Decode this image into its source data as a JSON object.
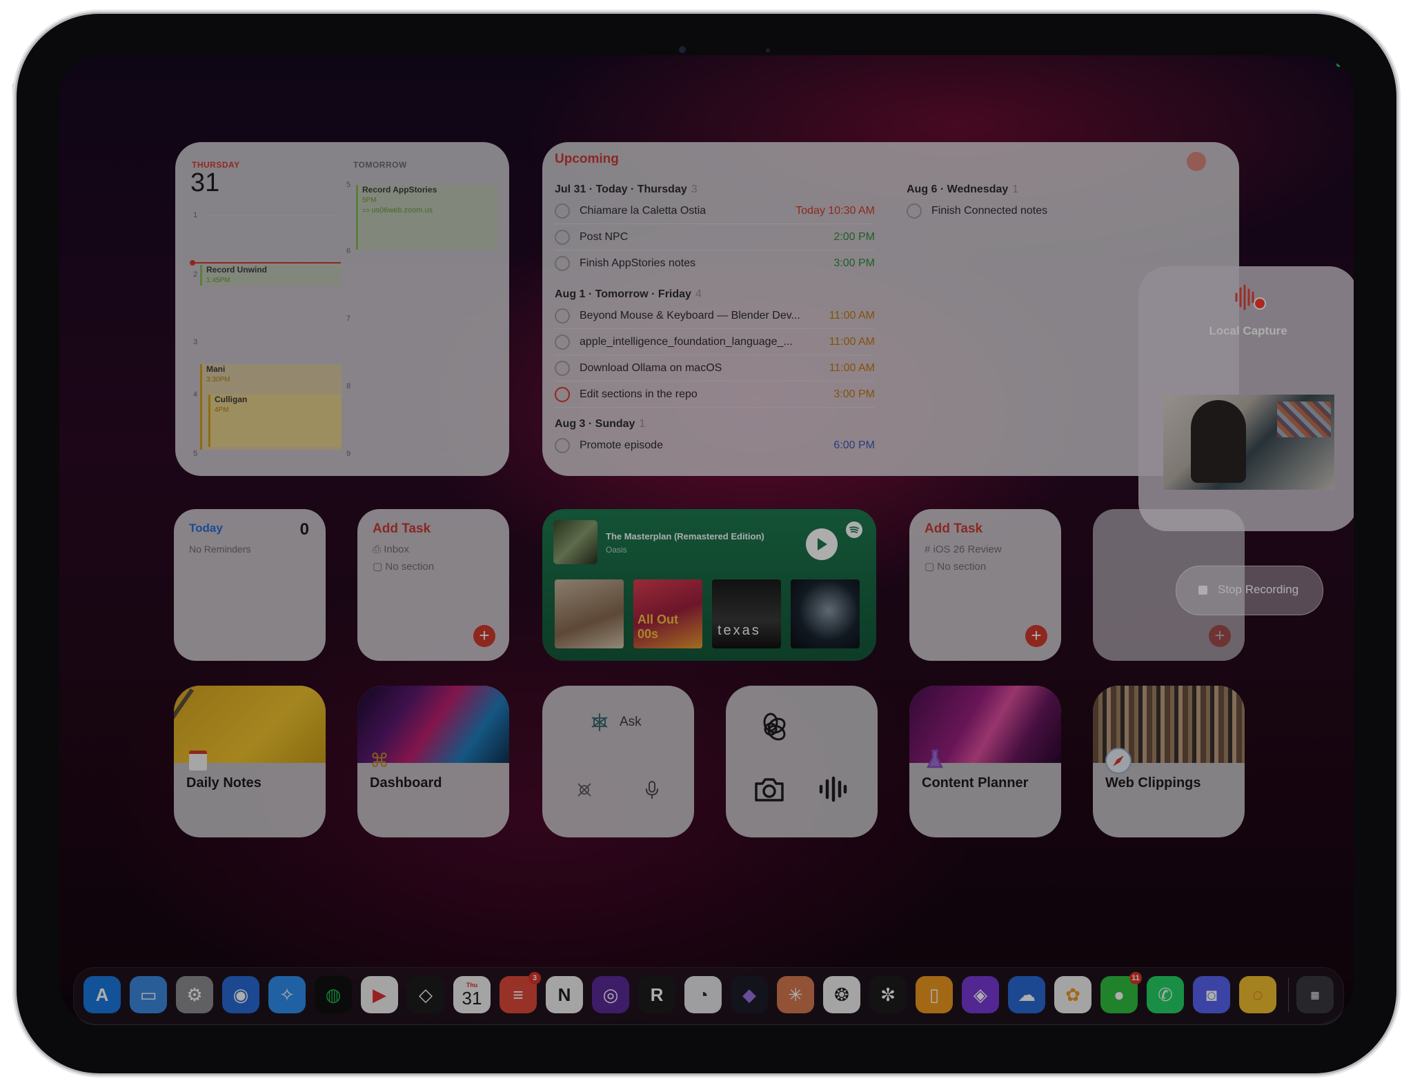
{
  "calendar": {
    "today_label": "THURSDAY",
    "today_date": "31",
    "tomorrow_label": "TOMORROW",
    "left_hours": [
      "1",
      "2",
      "3",
      "4",
      "5"
    ],
    "right_hours": [
      "5",
      "6",
      "7",
      "8",
      "9"
    ],
    "events": [
      {
        "title": "Record Unwind",
        "time": "1:45PM"
      },
      {
        "title": "Mani",
        "time": "3:30PM"
      },
      {
        "title": "Culligan",
        "time": "4PM"
      }
    ],
    "tomorrow_event": {
      "title": "Record AppStories",
      "time": "5PM",
      "location": "us06web.zoom.us"
    }
  },
  "upcoming": {
    "title": "Upcoming",
    "sections": [
      {
        "label": "Jul 31 · Today · Thursday",
        "count": "3",
        "tasks": [
          {
            "name": "Chiamare la Caletta Ostia",
            "time": "Today 10:30 AM"
          },
          {
            "name": "Post NPC",
            "time": "2:00 PM"
          },
          {
            "name": "Finish AppStories notes",
            "time": "3:00 PM"
          }
        ]
      },
      {
        "label": "Aug 1 · Tomorrow · Friday",
        "count": "4",
        "tasks": [
          {
            "name": "Beyond Mouse & Keyboard — Blender Dev...",
            "time": "11:00 AM"
          },
          {
            "name": "apple_intelligence_foundation_language_...",
            "time": "11:00 AM"
          },
          {
            "name": "Download Ollama on macOS",
            "time": "11:00 AM"
          },
          {
            "name": "Edit sections in the repo",
            "time": "3:00 PM"
          }
        ]
      },
      {
        "label": "Aug 3 · Sunday",
        "count": "1",
        "tasks": [
          {
            "name": "Promote episode",
            "time": "6:00 PM"
          }
        ]
      },
      {
        "label": "Aug 6 · Wednesday",
        "count": "1",
        "tasks": [
          {
            "name": "Finish Connected notes",
            "time": ""
          }
        ]
      }
    ]
  },
  "local_capture": {
    "label": "Local Capture"
  },
  "stop_recording": {
    "label": "Stop Recording"
  },
  "reminders": {
    "title": "Today",
    "count": "0",
    "subtitle": "No Reminders"
  },
  "add_task_1": {
    "title": "Add Task",
    "project": "Inbox",
    "section": "No section"
  },
  "add_task_2": {
    "title": "Add Task",
    "project": "iOS 26 Review",
    "section": "No section"
  },
  "music": {
    "track": "The Masterplan (Remastered Edition)",
    "artist": "Oasis",
    "album_text_2": "All Out 00s",
    "album_text_3": "texas"
  },
  "apps": {
    "daily_notes": "Daily Notes",
    "dashboard": "Dashboard",
    "ask": "Ask",
    "content_planner": "Content Planner",
    "web_clippings": "Web Clippings"
  },
  "dock": {
    "calendar_day": "Thu",
    "calendar_date": "31",
    "todoist_badge": "3",
    "messages_badge": "11"
  },
  "colors": {
    "accent_red": "#c93b34",
    "green_time": "#2e8b3d",
    "orange_time": "#c07a10",
    "blue_time": "#3d58b8"
  }
}
